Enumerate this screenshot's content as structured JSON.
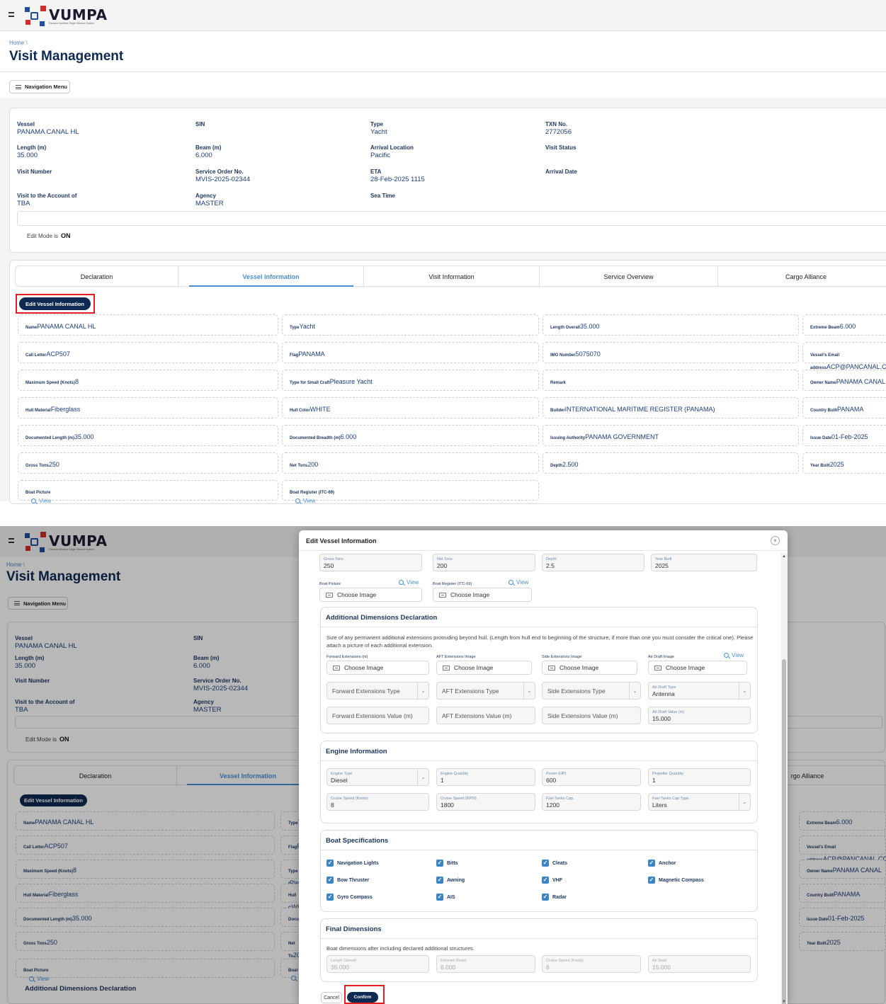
{
  "app": {
    "name": "VUMPA",
    "tagline": "Panama Maritime Single Window System"
  },
  "breadcrumb": "Home",
  "breadcrumb_sep": "\\",
  "page_title": "Visit Management",
  "nav_menu_label": "Navigation Menu",
  "summary": {
    "vessel": {
      "label": "Vessel",
      "value": "PANAMA CANAL HL"
    },
    "sin": {
      "label": "SIN",
      "value": ""
    },
    "type": {
      "label": "Type",
      "value": "Yacht"
    },
    "txn": {
      "label": "TXN No.",
      "value": "2772056"
    },
    "length": {
      "label": "Length (m)",
      "value": "35.000"
    },
    "beam": {
      "label": "Beam (m)",
      "value": "6.000"
    },
    "arrival_location": {
      "label": "Arrival Location",
      "value": "Pacific"
    },
    "visit_status": {
      "label": "Visit Status",
      "value": ""
    },
    "visit_number": {
      "label": "Visit Number",
      "value": ""
    },
    "service_order": {
      "label": "Service Order No.",
      "value": "MVIS-2025-02344"
    },
    "eta": {
      "label": "ETA",
      "value": "28-Feb-2025 1115"
    },
    "arrival_date": {
      "label": "Arrival Date",
      "value": ""
    },
    "account": {
      "label": "Visit to the Account of",
      "value": "TBA"
    },
    "agency": {
      "label": "Agency",
      "value": "MASTER"
    },
    "sea_time": {
      "label": "Sea Time",
      "value": ""
    }
  },
  "edit_mode": {
    "label": "Edit Mode is",
    "value": "ON"
  },
  "tabs": [
    "Declaration",
    "Vessel Information",
    "Visit Information",
    "Service Overview",
    "Cargo Alliance"
  ],
  "tabs_clipped_last": "rgo Alliance",
  "active_tab": "Vessel Information",
  "edit_vessel_button": "Edit Vessel Information",
  "vessel_fields": [
    {
      "label": "Name",
      "value": "PANAMA CANAL HL"
    },
    {
      "label": "Type",
      "value": "Yacht"
    },
    {
      "label": "Length Overall",
      "value": "35.000"
    },
    {
      "label": "Extreme Beam",
      "value": "6.000"
    },
    {
      "label": "Call Letter",
      "value": "ACP507"
    },
    {
      "label": "Flag",
      "value": "PANAMA"
    },
    {
      "label": "IMO Number",
      "value": "5075070"
    },
    {
      "label": "Vessel's Email address",
      "value": "ACP@PANCANAL.COM"
    },
    {
      "label": "Maximum Speed (Knots)",
      "value": "8"
    },
    {
      "label": "Type for Small Craft",
      "value": "Pleasure Yacht"
    },
    {
      "label": "Remark",
      "value": ""
    },
    {
      "label": "Owner Name",
      "value": "PANAMA CANAL"
    },
    {
      "label": "Hull Material",
      "value": "Fiberglass"
    },
    {
      "label": "Hull Color",
      "value": "WHITE"
    },
    {
      "label": "Builder",
      "value": "INTERNATIONAL MARITIME REGISTER (PANAMA)"
    },
    {
      "label": "Country Built",
      "value": "PANAMA"
    },
    {
      "label": "Documented Length (m)",
      "value": "35.000"
    },
    {
      "label": "Documented Breadth (m)",
      "value": "6.000"
    },
    {
      "label": "Issuing Authority",
      "value": "PANAMA GOVERNMENT"
    },
    {
      "label": "Issue Date",
      "value": "01-Feb-2025"
    },
    {
      "label": "Gross Tons",
      "value": "250"
    },
    {
      "label": "Net Tons",
      "value": "200"
    },
    {
      "label": "Depth",
      "value": "2.500"
    },
    {
      "label": "Year Built",
      "value": "2025"
    }
  ],
  "clipped_bg": {
    "type": "Yach",
    "flag": "PAN",
    "type_small": "Type f",
    "type_small_val": "Plea",
    "hull_color": "Hull C",
    "hull_color_val": "WHI",
    "doc": "Docur",
    "doc_val": "6.00",
    "net": "Net To",
    "net_val": "200",
    "boat_reg": "Boat F"
  },
  "boat_picture": {
    "label": "Boat Picture",
    "link": "View"
  },
  "boat_register": {
    "label": "Boat Register (ITC-69)",
    "link": "View"
  },
  "bg_section_peek": "Additional Dimensions Declaration",
  "modal": {
    "title": "Edit Vessel Information",
    "close": "×",
    "top_row": [
      {
        "label": "Gross Tons",
        "value": "250"
      },
      {
        "label": "Net Tons",
        "value": "200"
      },
      {
        "label": "Depth",
        "value": "2.5"
      },
      {
        "label": "Year Built",
        "value": "2025"
      }
    ],
    "boat_picture": {
      "label": "Boat Picture",
      "link": "View",
      "button": "Choose Image"
    },
    "boat_register": {
      "label": "Boat Register (ITC-69)",
      "link": "View",
      "button": "Choose Image"
    },
    "add_dims": {
      "title": "Additional Dimensions Declaration",
      "description": "Size of any permanent additional extensions protruding beyond hull. (Length from hull end to beginning of the structure, if more than one you must consider the critical one). Please attach a picture of each additional extension.",
      "images": [
        {
          "label": "Forward Extensions (m)",
          "button": "Choose Image"
        },
        {
          "label": "AFT Extensions Image",
          "button": "Choose Image"
        },
        {
          "label": "Side Extensions Image",
          "button": "Choose Image"
        },
        {
          "label": "Air Draft Image",
          "button": "Choose Image",
          "link": "View"
        }
      ],
      "types": [
        {
          "placeholder": "Forward Extensions Type"
        },
        {
          "placeholder": "AFT Extensions Type"
        },
        {
          "placeholder": "Side Extensions Type"
        },
        {
          "label": "Air Draft Type",
          "value": "Antenna"
        }
      ],
      "values": [
        {
          "placeholder": "Forward Extensions Value (m)"
        },
        {
          "placeholder": "AFT Extensions Value (m)"
        },
        {
          "placeholder": "Side Extensions Value (m)"
        },
        {
          "label": "Air Draft Value (m)",
          "value": "15.000"
        }
      ]
    },
    "engine": {
      "title": "Engine Information",
      "fields": [
        {
          "label": "Engine Type",
          "value": "Diesel"
        },
        {
          "label": "Engine Quantity",
          "value": "1"
        },
        {
          "label": "Power (HP)",
          "value": "600"
        },
        {
          "label": "Propeller Quantity",
          "value": "1"
        },
        {
          "label": "Cruise Speed (Knots)",
          "value": "8"
        },
        {
          "label": "Cruise Speed (RPM)",
          "value": "1800"
        },
        {
          "label": "Fuel Tanks Cap.",
          "value": "1200"
        },
        {
          "label": "Fuel Tanks Cap Type.",
          "value": "Liters"
        }
      ]
    },
    "specs": {
      "title": "Boat Specifications",
      "items": [
        "Navigation Lights",
        "Bitts",
        "Cleats",
        "Anchor",
        "Bow Thruster",
        "Awning",
        "VHF",
        "Magnetic Compass",
        "Gyro Compass",
        "AIS",
        "Radar"
      ]
    },
    "final": {
      "title": "Final Dimensions",
      "description": "Boat dimensions after including declared additional structures.",
      "fields": [
        {
          "label": "Length Overall",
          "value": "35.000"
        },
        {
          "label": "Extream Beam",
          "value": "6.000"
        },
        {
          "label": "Cruise Speed (Knots)",
          "value": "8"
        },
        {
          "label": "Air Draft",
          "value": "15.000"
        }
      ]
    },
    "cancel": "Cancel",
    "confirm": "Confirm"
  },
  "colors": {
    "primary": "#0e2a52",
    "accent": "#4a8fd6",
    "highlight": "#e02020",
    "check": "#3a85c8"
  }
}
